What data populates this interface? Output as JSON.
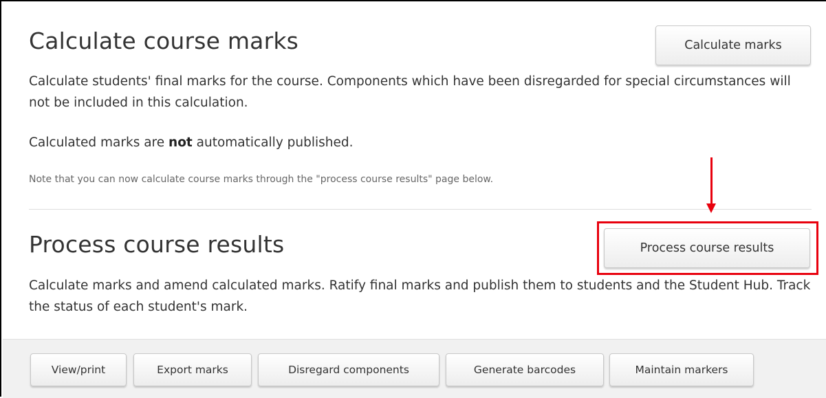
{
  "calculate": {
    "title": "Calculate course marks",
    "button_label": "Calculate marks",
    "description": "Calculate students' final marks for the course. Components which have been disregarded for special circumstances will not be included in this calculation.",
    "publish_prefix": "Calculated marks are ",
    "publish_emphasis": "not",
    "publish_suffix": " automatically published.",
    "note": "Note that you can now calculate course marks through the \"process course results\" page below."
  },
  "process": {
    "title": "Process course results",
    "button_label": "Process course results",
    "description": "Calculate marks and amend calculated marks. Ratify final marks and publish them to students and the Student Hub. Track the status of each student's mark."
  },
  "footer": {
    "buttons": [
      "View/print",
      "Export marks",
      "Disregard components",
      "Generate barcodes",
      "Maintain markers"
    ]
  },
  "annotation": {
    "color": "#e8000d"
  }
}
